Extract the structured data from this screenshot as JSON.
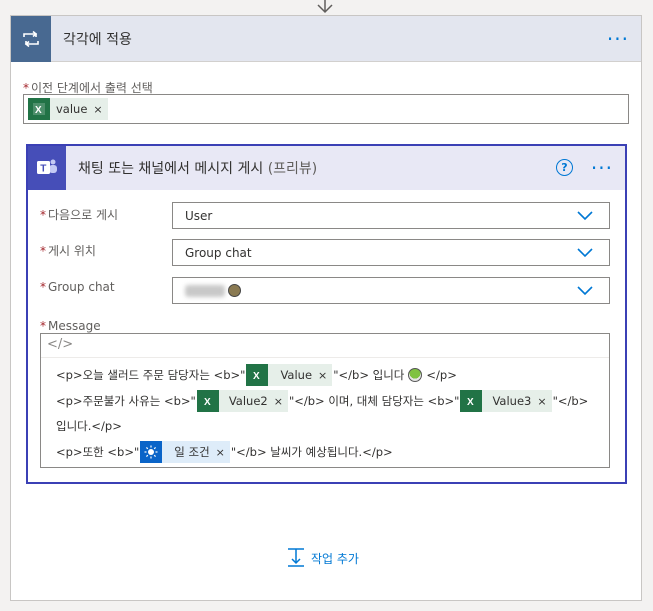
{
  "outer": {
    "title": "각각에 적용",
    "more_label": "···",
    "prev_output": {
      "required_mark": "*",
      "label": "이전 단계에서 출력 선택",
      "token": "value"
    }
  },
  "inner": {
    "title": "채팅 또는 채널에서 메시지 게시",
    "preview": "(프리뷰)",
    "help_label": "?",
    "more_label": "···",
    "post_as": {
      "required_mark": "*",
      "label": "다음으로 게시",
      "value": "User"
    },
    "post_in": {
      "required_mark": "*",
      "label": "게시 위치",
      "value": "Group chat"
    },
    "group_chat": {
      "required_mark": "*",
      "label": "Group chat"
    },
    "message": {
      "required_mark": "*",
      "label": "Message",
      "code_glyph": "</>",
      "line1": {
        "pre": "<p>오늘 샐러드 주문 담당자는 <b>\"",
        "token": "Value",
        "post": "\"</b> 입니다",
        "end": "</p>"
      },
      "line2": {
        "pre": "<p>주문불가 사유는 <b>\"",
        "token1": "Value2",
        "mid": "\"</b> 이며, 대체 담당자는 <b>\"",
        "token2": "Value3",
        "post": "\"</b>"
      },
      "line3": {
        "text": "입니다.</p>"
      },
      "line4": {
        "pre": "<p>또한 <b>\"",
        "token": "일 조건",
        "post": "\"</b> 날씨가 예상됩니다.</p>"
      }
    }
  },
  "add_action": {
    "label": "작업 추가"
  },
  "close_glyph": "×",
  "colors": {
    "accent": "#0078d4",
    "teams": "#464eb8",
    "loop": "#486991",
    "excel": "#217346",
    "required": "#a4262c"
  },
  "icons": {
    "top": "arrow-down-icon",
    "loop": "loop-icon",
    "teams": "teams-icon",
    "excel": "excel-icon",
    "weather": "sun-icon",
    "chevron": "chevron-down-icon",
    "add": "add-action-icon"
  }
}
